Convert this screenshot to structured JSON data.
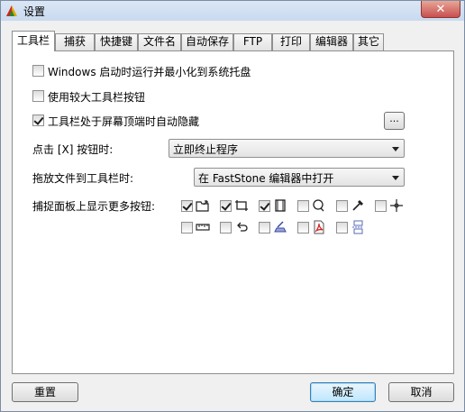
{
  "window": {
    "title": "设置",
    "close_label": "✕"
  },
  "tabs": [
    {
      "label": "工具栏",
      "active": true
    },
    {
      "label": "捕获"
    },
    {
      "label": "快捷键"
    },
    {
      "label": "文件名"
    },
    {
      "label": "自动保存"
    },
    {
      "label": "FTP"
    },
    {
      "label": "打印"
    },
    {
      "label": "编辑器"
    },
    {
      "label": "其它"
    }
  ],
  "options": {
    "minimize_to_tray": {
      "label": "Windows 启动时运行并最小化到系统托盘",
      "checked": false
    },
    "larger_buttons": {
      "label": "使用较大工具栏按钮",
      "checked": false
    },
    "auto_hide": {
      "label": "工具栏处于屏幕顶端时自动隐藏",
      "checked": true,
      "more_label": "..."
    }
  },
  "close_action": {
    "label": "点击 [X] 按钮时:",
    "value": "立即终止程序"
  },
  "drag_action": {
    "label": "拖放文件到工具栏时:",
    "value": "在 FastStone 编辑器中打开"
  },
  "capture_panel": {
    "label": "捕捉面板上显示更多按钮:",
    "buttons": [
      {
        "icon": "open-folder-icon",
        "checked": true
      },
      {
        "icon": "crop-icon",
        "checked": true
      },
      {
        "icon": "film-strip-icon",
        "checked": true
      },
      {
        "icon": "magnifier-icon",
        "checked": false
      },
      {
        "icon": "color-picker-icon",
        "checked": false
      },
      {
        "icon": "crosshair-icon",
        "checked": false
      },
      {
        "icon": "ruler-icon",
        "checked": false
      },
      {
        "icon": "undo-arrow-icon",
        "checked": false
      },
      {
        "icon": "scanner-icon",
        "checked": false
      },
      {
        "icon": "pdf-icon",
        "checked": false
      },
      {
        "icon": "split-page-icon",
        "checked": false
      }
    ]
  },
  "footer": {
    "reset_label": "重置",
    "ok_label": "确定",
    "cancel_label": "取消"
  },
  "colors": {
    "accent": "#3c7fb1",
    "pdf": "#d42020"
  }
}
